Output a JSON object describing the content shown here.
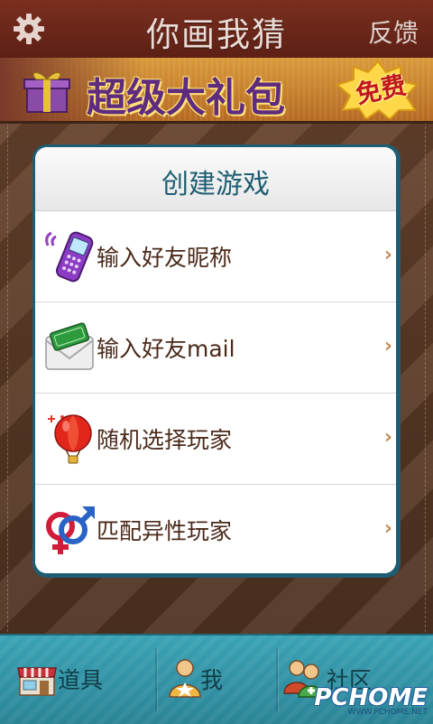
{
  "header": {
    "title": "你画我猜",
    "feedback_label": "反馈",
    "settings_icon": "gear-icon"
  },
  "banner": {
    "text": "超级大礼包",
    "badge": "免费",
    "icon": "gift-box-icon"
  },
  "dialog": {
    "title": "创建游戏",
    "items": [
      {
        "label": "输入好友昵称",
        "icon": "mobile-phone-icon"
      },
      {
        "label": "输入好友mail",
        "icon": "email-envelope-icon"
      },
      {
        "label": "随机选择玩家",
        "icon": "hot-air-balloon-icon"
      },
      {
        "label": "匹配异性玩家",
        "icon": "gender-symbols-icon"
      }
    ],
    "chevron": "›"
  },
  "tabbar": {
    "tabs": [
      {
        "label": "道具",
        "icon": "shop-icon"
      },
      {
        "label": "我",
        "icon": "user-star-icon"
      },
      {
        "label": "社区",
        "icon": "community-icon"
      }
    ]
  },
  "watermark": {
    "main": "PCHOME",
    "sub": "WWW.PCHOME.NET"
  },
  "colors": {
    "accent": "#1f5e72",
    "tabbar": "#3aa3b5",
    "topbar": "#6b2818"
  }
}
